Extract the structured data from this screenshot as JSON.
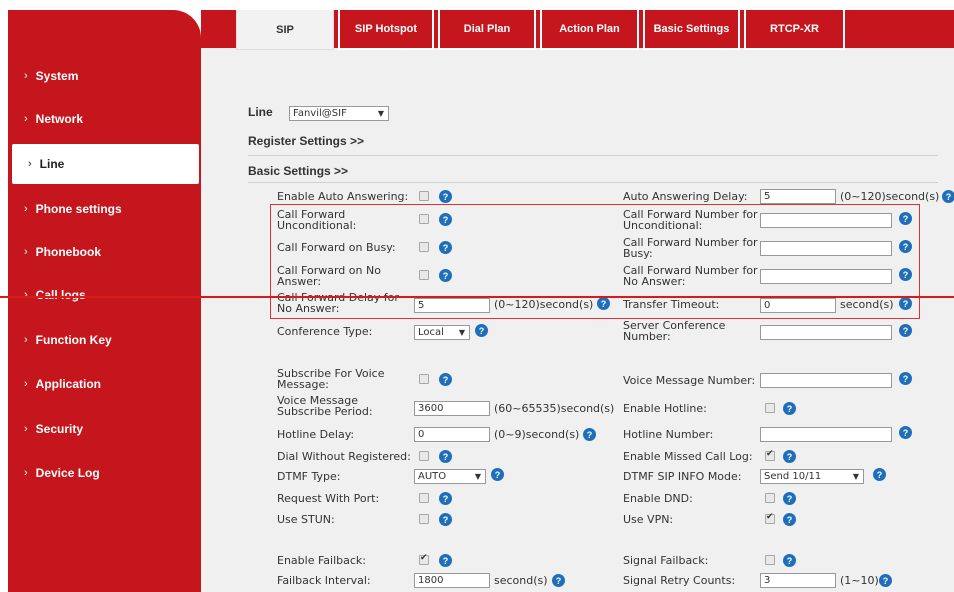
{
  "tabs": [
    "SIP",
    "SIP Hotspot",
    "Dial Plan",
    "Action Plan",
    "Basic Settings",
    "RTCP-XR"
  ],
  "sidebar": [
    "System",
    "Network",
    "Line",
    "Phone settings",
    "Phonebook",
    "Call logs",
    "Function Key",
    "Application",
    "Security",
    "Device Log"
  ],
  "line": {
    "label": "Line",
    "value": "Fanvil@SIF"
  },
  "sections": {
    "register": "Register Settings >>",
    "basic": "Basic Settings >>"
  },
  "form": {
    "auto_answer": "Enable Auto Answering:",
    "auto_answer_delay": "Auto Answering Delay:",
    "auto_answer_delay_value": "5",
    "auto_answer_delay_unit": "(0~120)second(s)",
    "cf_uncond": "Call Forward Unconditional:",
    "cf_uncond_num": "Call Forward Number for Unconditional:",
    "cf_busy": "Call Forward on Busy:",
    "cf_busy_num": "Call Forward Number for Busy:",
    "cf_noans": "Call Forward on No Answer:",
    "cf_noans_num": "Call Forward Number for No Answer:",
    "cf_delay": "Call Forward Delay for No Answer:",
    "cf_delay_value": "5",
    "cf_delay_unit": "(0~120)second(s)",
    "transfer_timeout": "Transfer Timeout:",
    "transfer_timeout_value": "0",
    "transfer_timeout_unit": "second(s)",
    "conf_type": "Conference Type:",
    "conf_type_value": "Local",
    "server_conf": "Server Conference Number:",
    "sub_vm": "Subscribe For Voice Message:",
    "vm_number": "Voice Message Number:",
    "vm_period": "Voice Message Subscribe Period:",
    "vm_period_value": "3600",
    "vm_period_unit": "(60~65535)second(s)",
    "hotline_en": "Enable Hotline:",
    "hotline_delay": "Hotline Delay:",
    "hotline_delay_value": "0",
    "hotline_delay_unit": "(0~9)second(s)",
    "hotline_num": "Hotline Number:",
    "dial_wo_reg": "Dial Without Registered:",
    "missed_log": "Enable Missed Call Log:",
    "dtmf_type": "DTMF Type:",
    "dtmf_type_value": "AUTO",
    "dtmf_sip": "DTMF SIP INFO Mode:",
    "dtmf_sip_value": "Send 10/11",
    "req_port": "Request With Port:",
    "dnd": "Enable DND:",
    "stun": "Use STUN:",
    "vpn": "Use VPN:",
    "failback": "Enable Failback:",
    "sig_failback": "Signal Failback:",
    "failback_int": "Failback Interval:",
    "failback_int_value": "1800",
    "failback_int_unit": "second(s)",
    "sig_retry": "Signal Retry Counts:",
    "sig_retry_value": "3",
    "sig_retry_unit": "(1~10)"
  },
  "colors": {
    "brand": "#c4161c",
    "help": "#1e6fba",
    "highlight": "#e03030"
  }
}
